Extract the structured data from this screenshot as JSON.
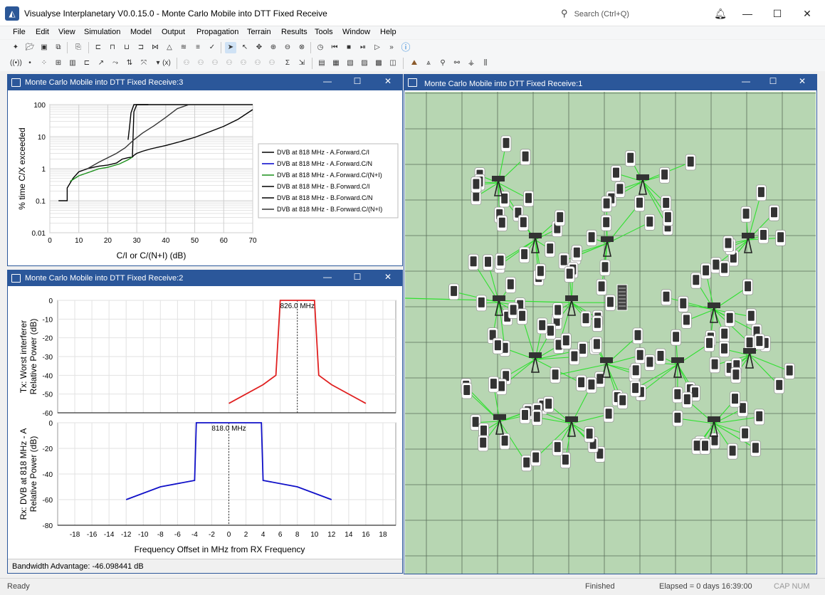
{
  "app": {
    "title": "Visualyse Interplanetary V0.0.15.0 - Monte Carlo Mobile into DTT Fixed Receive",
    "search_placeholder": "Search (Ctrl+Q)",
    "icon": "app-logo-icon"
  },
  "menu": [
    "File",
    "Edit",
    "View",
    "Simulation",
    "Model",
    "Output",
    "Propagation",
    "Terrain",
    "Results",
    "Tools",
    "Window",
    "Help"
  ],
  "windows": {
    "cdf": {
      "title": "Monte Carlo Mobile into DTT Fixed Receive:3",
      "chart_data": {
        "type": "line",
        "xlabel": "C/I or C/(N+I) (dB)",
        "ylabel": "% time C/X exceeded",
        "xlim": [
          0,
          70
        ],
        "ylim": [
          0.01,
          100
        ],
        "y_scale": "log",
        "x_ticks": [
          "0",
          "10",
          "20",
          "30",
          "40",
          "50",
          "60",
          "70"
        ],
        "y_ticks": [
          "0.01",
          "0.1",
          "1",
          "10",
          "100"
        ],
        "legend_position": "right",
        "series": [
          {
            "name": "DVB at 818 MHz - A.Forward.C/I",
            "color": "#000000",
            "x": [
              3,
              6,
              6,
              8,
              10,
              13,
              15,
              17,
              20,
              23,
              25,
              27,
              28.5,
              29,
              30,
              31,
              33,
              40,
              45,
              70
            ],
            "y": [
              0.1,
              0.1,
              0.25,
              0.5,
              0.8,
              1.0,
              1.1,
              1.2,
              1.3,
              1.5,
              2,
              2.2,
              2.3,
              60,
              100,
              100,
              100,
              100,
              100,
              100
            ]
          },
          {
            "name": "DVB at 818 MHz - A.Forward.C/N",
            "color": "#0000cc",
            "x": [],
            "y": []
          },
          {
            "name": "DVB at 818 MHz - A.Forward.C/(N+I)",
            "color": "#1a8f1a",
            "x": [
              7,
              10,
              14,
              17,
              20,
              24,
              27,
              28.5
            ],
            "y": [
              0.4,
              0.6,
              0.8,
              1.0,
              1.1,
              1.4,
              1.9,
              2.3
            ]
          },
          {
            "name": "DVB at 818 MHz - B.Forward.C/I",
            "color": "#000000",
            "x": [
              28.5,
              29,
              30,
              32,
              35,
              40,
              45,
              50,
              55,
              60,
              65,
              70
            ],
            "y": [
              2.3,
              2.6,
              3.0,
              3.5,
              4.2,
              5.3,
              7.0,
              9.5,
              14,
              21,
              35,
              70
            ]
          },
          {
            "name": "DVB at 818 MHz - B.Forward.C/N",
            "color": "#000000",
            "x": [
              27,
              27.5,
              28,
              29,
              31,
              34
            ],
            "y": [
              8,
              20,
              55,
              100,
              100,
              100
            ]
          },
          {
            "name": "DVB at 818 MHz - B.Forward.C/(N+I)",
            "color": "#333333",
            "x": [
              13,
              17,
              20,
              23,
              26,
              29,
              32,
              36,
              40,
              44,
              48,
              50,
              70
            ],
            "y": [
              1.0,
              1.6,
              2.2,
              3.0,
              4.5,
              8,
              13,
              22,
              40,
              75,
              100,
              100,
              100
            ]
          }
        ]
      }
    },
    "mask": {
      "title": "Monte Carlo Mobile into DTT Fixed Receive:2",
      "footer": "Bandwidth Advantage: -46.098441 dB",
      "xlabel": "Frequency Offset in MHz from RX Frequency",
      "chart_data": [
        {
          "type": "line",
          "ylabel_line1": "Tx: Worst interferer",
          "ylabel_line2": "Relative Power (dB)",
          "ylim": [
            -60,
            0
          ],
          "xlim": [
            -20,
            19.5
          ],
          "y_ticks": [
            "0",
            "-10",
            "-20",
            "-30",
            "-40",
            "-50",
            "-60"
          ],
          "marker_label": "826.0 MHz",
          "marker_x": 8,
          "series": [
            {
              "color": "#e02020",
              "x": [
                0,
                4,
                5.5,
                6,
                10,
                10.5,
                12,
                16
              ],
              "y": [
                -55,
                -45,
                -40,
                0,
                0,
                -40,
                -45,
                -55
              ]
            }
          ]
        },
        {
          "type": "line",
          "ylabel_line1": "Rx: DVB at 818 MHz - A",
          "ylabel_line2": "Relative Power (dB)",
          "ylim": [
            -80,
            0
          ],
          "xlim": [
            -20,
            19.5
          ],
          "y_ticks": [
            "0",
            "-20",
            "-40",
            "-60",
            "-80"
          ],
          "x_ticks": [
            "-18",
            "-16",
            "-14",
            "-12",
            "-10",
            "-8",
            "-6",
            "-4",
            "-2",
            "0",
            "2",
            "4",
            "6",
            "8",
            "10",
            "12",
            "14",
            "16",
            "18"
          ],
          "marker_label": "818.0 MHz",
          "marker_x": 0,
          "series": [
            {
              "color": "#1010c8",
              "x": [
                -12,
                -8,
                -4,
                -3.8,
                3.8,
                4,
                8,
                12
              ],
              "y": [
                -60,
                -50,
                -45,
                0,
                0,
                -45,
                -50,
                -60
              ]
            }
          ]
        }
      ]
    },
    "map": {
      "title": "Monte Carlo Mobile into DTT Fixed Receive:1",
      "background": "#b7d6b2",
      "grid_color": "#5a6e5a",
      "link_color": "#30e030"
    }
  },
  "status": {
    "left": "Ready",
    "state": "Finished",
    "elapsed": "Elapsed = 0 days 16:39:00",
    "keys": "CAP NUM"
  }
}
